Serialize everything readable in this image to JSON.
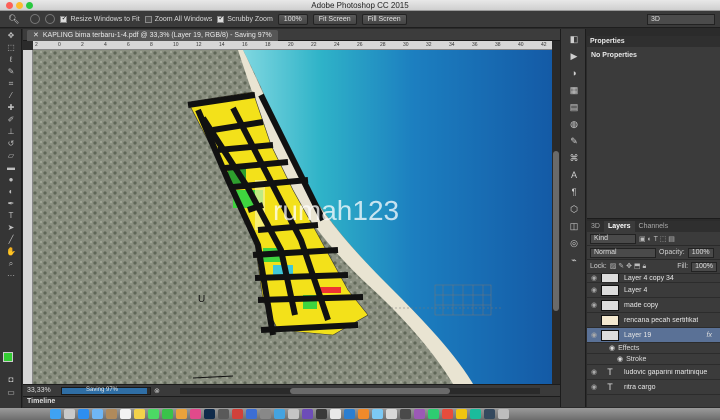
{
  "window": {
    "title": "Adobe Photoshop CC 2015"
  },
  "options_bar": {
    "resize_windows": {
      "label": "Resize Windows to Fit",
      "checked": true
    },
    "zoom_all_windows": {
      "label": "Zoom All Windows",
      "checked": false
    },
    "scrubby_zoom": {
      "label": "Scrubby Zoom",
      "checked": true
    },
    "btn_100": "100%",
    "fit_screen": "Fit Screen",
    "fill_screen": "Fill Screen",
    "workspace": "3D"
  },
  "document": {
    "tab_label": "KAPLING bima terbaru-1-4.pdf @ 33,3% (Layer 19, RGB/8) - Saving 97%",
    "ruler_ticks": [
      "2",
      "0",
      "2",
      "4",
      "6",
      "8",
      "10",
      "12",
      "14",
      "16",
      "18",
      "20",
      "22",
      "24",
      "26",
      "28",
      "30",
      "32",
      "34",
      "36",
      "38",
      "40",
      "42"
    ],
    "watermark": "rumah123",
    "map_label": "U"
  },
  "status_bar": {
    "zoom": "33,33%",
    "progress_label": "Saving 97%",
    "progress": 0.97
  },
  "timeline": {
    "label": "Timeline"
  },
  "properties": {
    "title": "Properties",
    "body": "No Properties"
  },
  "layers_panel": {
    "tabs": [
      "3D",
      "Layers",
      "Channels"
    ],
    "active_tab": "Layers",
    "kind": "Kind",
    "blend_mode": "Normal",
    "opacity_label": "Opacity:",
    "opacity": "100%",
    "lock_label": "Lock:",
    "fill_label": "Fill:",
    "fill": "100%",
    "layers": [
      {
        "name": "Layer 4 copy 34",
        "type": "image"
      },
      {
        "name": "Layer 4",
        "type": "image"
      },
      {
        "name": "made copy",
        "type": "image"
      },
      {
        "name": "rencana pecah sertifikat",
        "type": "image"
      },
      {
        "name": "Layer 19",
        "type": "image",
        "selected": true,
        "fx": "fx"
      },
      {
        "name": "Effects",
        "type": "effect-header"
      },
      {
        "name": "Stroke",
        "type": "effect"
      },
      {
        "name": "ludovic gaparini martinique",
        "type": "text"
      },
      {
        "name": "ritra cargo",
        "type": "text"
      }
    ]
  },
  "colors": {
    "foreground": "#33cc33",
    "background": "#ffffff",
    "plot_yellow": "#f3e11a",
    "plot_green": "#3fd43f",
    "road": "#111111",
    "sea": "#1f7fc9",
    "selection": "#5a7196"
  },
  "icons": {
    "tools": [
      "move-tool",
      "marquee-tool",
      "lasso-tool",
      "quick-select-tool",
      "crop-tool",
      "eyedropper-tool",
      "healing-tool",
      "brush-tool",
      "clone-tool",
      "history-brush-tool",
      "eraser-tool",
      "gradient-tool",
      "blur-tool",
      "dodge-tool",
      "pen-tool",
      "type-tool",
      "path-select-tool",
      "shape-tool",
      "hand-tool",
      "zoom-tool"
    ],
    "strip": [
      "history-icon",
      "play-icon",
      "adjustments-icon",
      "styles-icon",
      "swatches-icon",
      "color-icon",
      "brushes-icon",
      "clone-source-icon",
      "character-icon",
      "paragraph-icon",
      "3d-icon",
      "layers-icon",
      "channels-icon",
      "paths-icon"
    ]
  }
}
